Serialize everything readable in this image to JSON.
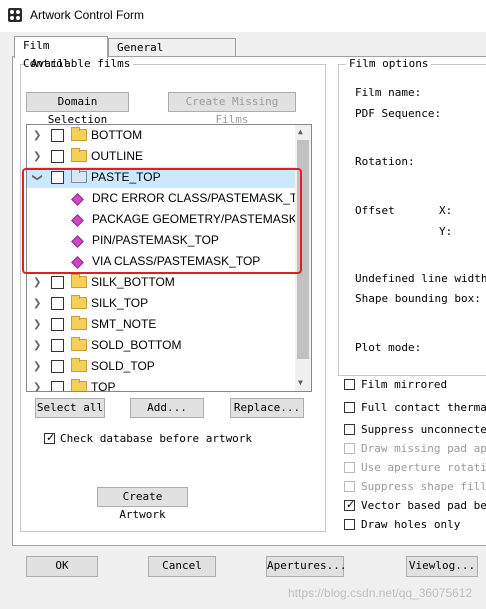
{
  "window": {
    "title": "Artwork Control Form"
  },
  "tabs": [
    {
      "label": "Film Control"
    },
    {
      "label": "General Parameters"
    }
  ],
  "available_films": {
    "legend": "Available films",
    "domain_selection": "Domain Selection",
    "create_missing": "Create Missing Films",
    "tree": [
      {
        "label": "BOTTOM",
        "type": "folder"
      },
      {
        "label": "OUTLINE",
        "type": "folder"
      },
      {
        "label": "PASTE_TOP",
        "type": "folder-open"
      },
      {
        "label": "DRC ERROR CLASS/PASTEMASK_TO",
        "type": "layer"
      },
      {
        "label": "PACKAGE GEOMETRY/PASTEMASK",
        "type": "layer"
      },
      {
        "label": "PIN/PASTEMASK_TOP",
        "type": "layer"
      },
      {
        "label": "VIA CLASS/PASTEMASK_TOP",
        "type": "layer"
      },
      {
        "label": "SILK_BOTTOM",
        "type": "folder"
      },
      {
        "label": "SILK_TOP",
        "type": "folder"
      },
      {
        "label": "SMT_NOTE",
        "type": "folder"
      },
      {
        "label": "SOLD_BOTTOM",
        "type": "folder"
      },
      {
        "label": "SOLD_TOP",
        "type": "folder"
      },
      {
        "label": "TOP",
        "type": "folder"
      }
    ],
    "select_all": "Select all",
    "add": "Add...",
    "replace": "Replace...",
    "check_db_label": "Check database before artwork",
    "check_db_checked": true,
    "create_artwork": "Create Artwork"
  },
  "film_options": {
    "legend": "Film options",
    "film_name": "Film name:",
    "pdf_sequence": "PDF Sequence:",
    "rotation": "Rotation:",
    "offset": "Offset",
    "x": "X:",
    "y": "Y:",
    "undefined_line_width": "Undefined line width:",
    "shape_bounding_box": "Shape bounding box:",
    "plot_mode": "Plot mode:",
    "options": [
      {
        "label": "Film mirrored",
        "checked": false,
        "enabled": true
      },
      {
        "label": "Full contact thermal-",
        "checked": false,
        "enabled": true
      },
      {
        "label": "Suppress unconnected",
        "checked": false,
        "enabled": true
      },
      {
        "label": "Draw missing pad aper",
        "checked": false,
        "enabled": false
      },
      {
        "label": "Use aperture rotation",
        "checked": false,
        "enabled": false
      },
      {
        "label": "Suppress shape fill",
        "checked": false,
        "enabled": false
      },
      {
        "label": "Vector based pad beha",
        "checked": true,
        "enabled": true
      },
      {
        "label": "Draw holes only",
        "checked": false,
        "enabled": true
      }
    ]
  },
  "footer": {
    "ok": "OK",
    "cancel": "Cancel",
    "apertures": "Apertures...",
    "viewlog": "Viewlog...",
    "watermark": "https://blog.csdn.net/qq_36075612"
  }
}
